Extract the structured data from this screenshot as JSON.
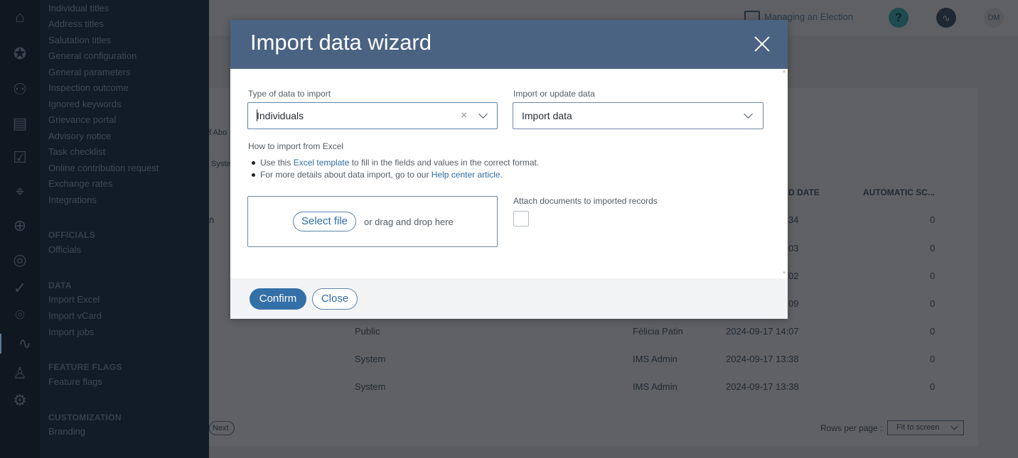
{
  "sidebar": {
    "items_top": [
      "Individual titles",
      "Address titles",
      "Salutation titles",
      "General configuration",
      "General parameters",
      "Inspection outcome",
      "Ignored keywords",
      "Grievance portal",
      "Advisory notice",
      "Task checklist",
      "Online contribution request",
      "Exchange rates",
      "Integrations"
    ],
    "officials": {
      "heading": "OFFICIALS",
      "items": [
        "Officials"
      ]
    },
    "data": {
      "heading": "DATA",
      "items": [
        "Import Excel",
        "Import vCard",
        "Import jobs"
      ]
    },
    "feature_flags": {
      "heading": "FEATURE FLAGS",
      "items": [
        "Feature flags"
      ]
    },
    "customization": {
      "heading": "CUSTOMIZATION",
      "items": [
        "Branding"
      ]
    }
  },
  "topbar": {
    "breadcrumb": "Managing an Election",
    "help": "?",
    "avatar": "DM"
  },
  "background": {
    "frag_of": "f Abo",
    "frag_sys": "Syste",
    "frag_n": "n",
    "col_date": "D DATE",
    "col_auto": "AUTOMATIC SC...",
    "row_partial_times": [
      "34",
      "03",
      "02",
      "09"
    ],
    "row_partial_values": [
      "0",
      "0",
      "0",
      "0"
    ],
    "rows": [
      {
        "type": "Public",
        "user": "Félicia Patin",
        "date": "2024-09-17 14:07",
        "value": "0"
      },
      {
        "type": "System",
        "user": "IMS Admin",
        "date": "2024-09-17 13:38",
        "value": "0"
      },
      {
        "type": "System",
        "user": "IMS Admin",
        "date": "2024-09-17 13:38",
        "value": "0"
      }
    ],
    "next": "Next",
    "rows_per_page": "Rows per page :",
    "fit_to_screen": "Fit to screen"
  },
  "modal": {
    "title": "Import data wizard",
    "type_label": "Type of data to import",
    "type_value": "Individuals",
    "mode_label": "Import or update data",
    "mode_value": "Import data",
    "howto_title": "How to import from Excel",
    "bullet1_pre": "Use this ",
    "bullet1_link": "Excel template",
    "bullet1_post": " to fill in the fields and values in the correct format.",
    "bullet2_pre": "For more details about data import, go to our ",
    "bullet2_link": "Help center article",
    "bullet2_post": ".",
    "select_file": "Select file",
    "drag_text": "or drag and drop here",
    "attach_label": "Attach documents to imported records",
    "confirm": "Confirm",
    "close": "Close"
  }
}
